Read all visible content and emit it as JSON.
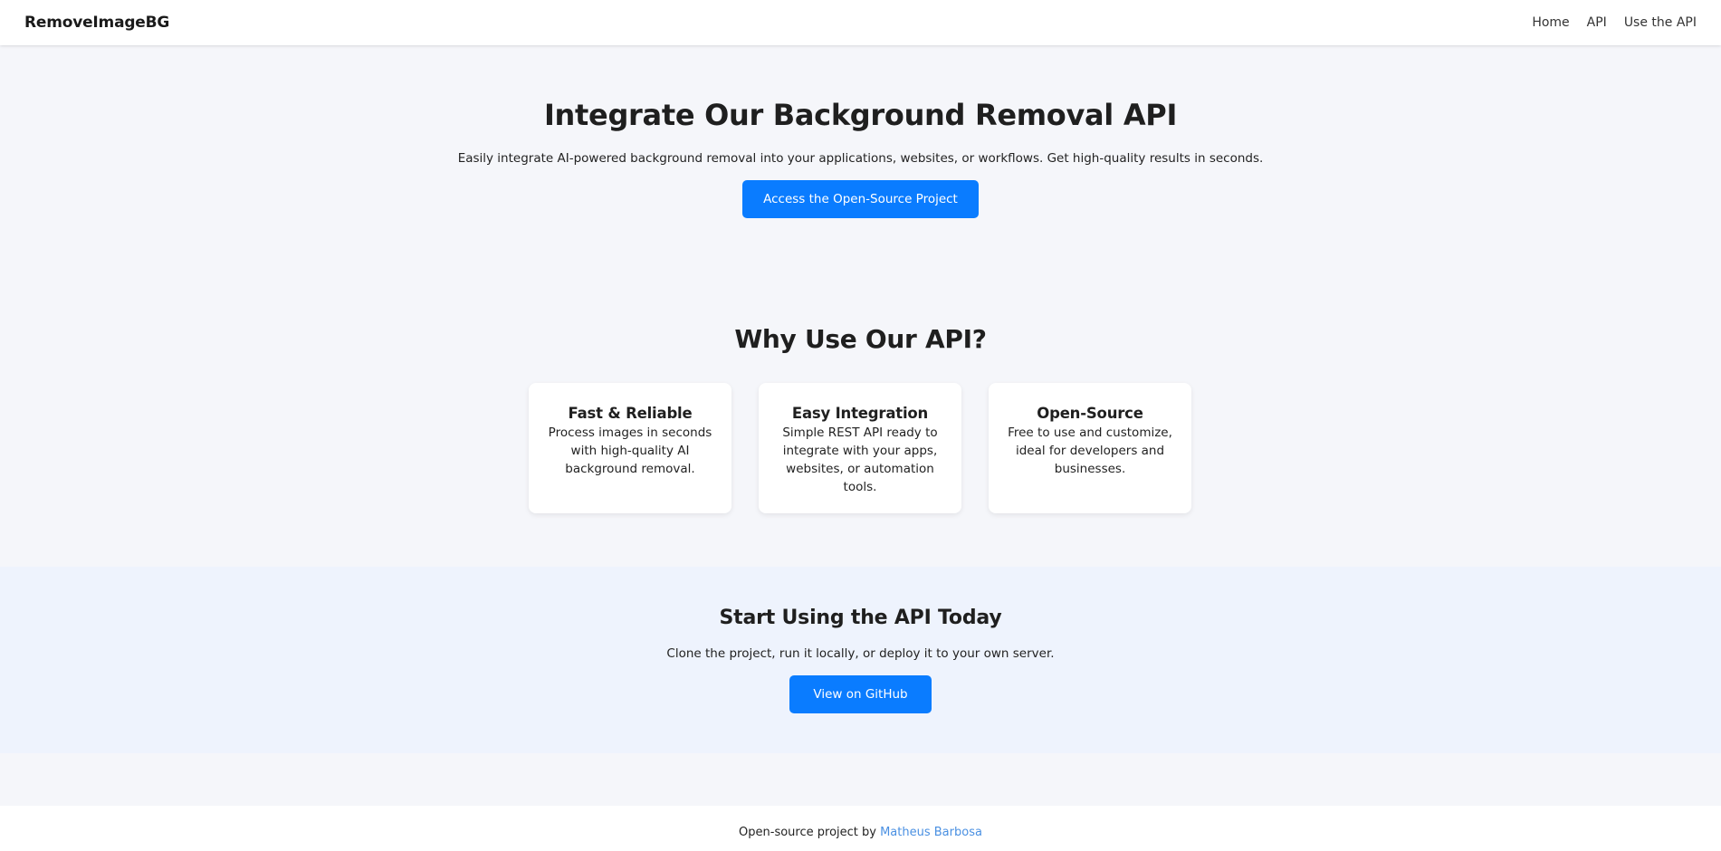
{
  "header": {
    "brand": "RemoveImageBG",
    "nav": [
      "Home",
      "API",
      "Use the API"
    ]
  },
  "hero": {
    "title": "Integrate Our Background Removal API",
    "subtitle": "Easily integrate AI-powered background removal into your applications, websites, or workflows. Get high-quality results in seconds.",
    "button_label": "Access the Open-Source Project"
  },
  "why": {
    "title": "Why Use Our API?",
    "cards": [
      {
        "title": "Fast & Reliable",
        "text": "Process images in seconds with high-quality AI background removal."
      },
      {
        "title": "Easy Integration",
        "text": "Simple REST API ready to integrate with your apps, websites, or automation tools."
      },
      {
        "title": "Open-Source",
        "text": "Free to use and customize, ideal for developers and businesses."
      }
    ]
  },
  "cta": {
    "title": "Start Using the API Today",
    "subtitle": "Clone the project, run it locally, or deploy it to your own server.",
    "button_label": "View on GitHub"
  },
  "footer": {
    "prefix": "Open-source project by ",
    "author": "Matheus Barbosa"
  },
  "colors": {
    "accent": "#0a7cff",
    "link": "#4a90e2",
    "page_bg": "#f5f6fa",
    "band_bg": "#eef3fd"
  }
}
